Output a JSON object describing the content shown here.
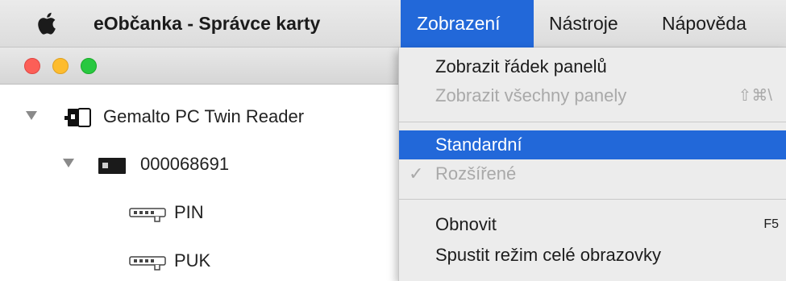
{
  "menubar": {
    "app_name": "eObčanka - Správce karty",
    "items": [
      {
        "label": "Zobrazení"
      },
      {
        "label": "Nástroje"
      },
      {
        "label": "Nápověda"
      }
    ]
  },
  "window": {
    "tree": [
      {
        "label": "Gemalto PC Twin Reader",
        "icon": "card-reader-icon"
      },
      {
        "label": "000068691",
        "icon": "smart-card-icon"
      },
      {
        "label": "PIN",
        "icon": "key-icon"
      },
      {
        "label": "PUK",
        "icon": "key-icon"
      }
    ]
  },
  "dropdown": {
    "items": [
      {
        "label": "Zobrazit řádek panelů",
        "shortcut": "",
        "enabled": true
      },
      {
        "label": "Zobrazit všechny panely",
        "shortcut": "⇧⌘\\",
        "enabled": false
      },
      {
        "label": "Standardní",
        "shortcut": "",
        "enabled": true,
        "highlighted": true
      },
      {
        "label": "Rozšířené",
        "shortcut": "",
        "enabled": false,
        "checked": true
      },
      {
        "label": "Obnovit",
        "shortcut": "F5",
        "enabled": true
      },
      {
        "label": "Spustit režim celé obrazovky",
        "shortcut": "",
        "enabled": true
      }
    ],
    "check_glyph": "✓"
  },
  "colors": {
    "highlight": "#2268d9",
    "close": "#fc5f57",
    "minimize": "#fdbc2e",
    "maximize": "#28c840"
  }
}
